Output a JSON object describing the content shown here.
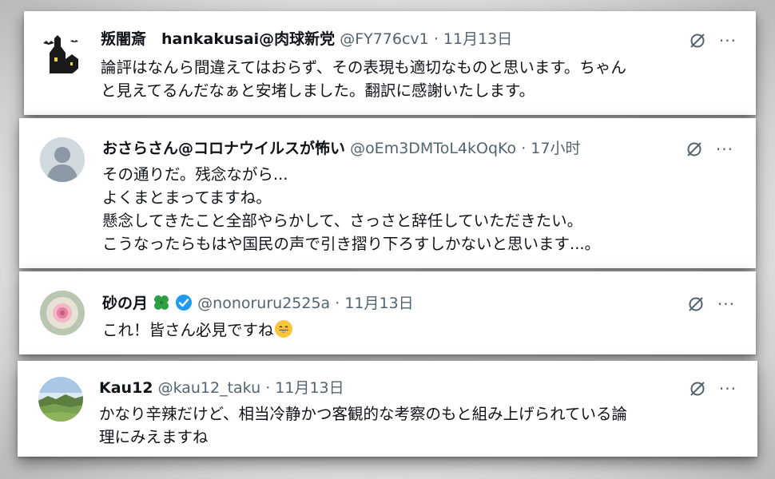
{
  "tweets": [
    {
      "name": "叛闇斎　hankakusai@肉球新党",
      "handle": "@FY776cv1",
      "time": "11月13日",
      "lines": [
        "論評はなんら間違えてはおらず、その表現も適切なものと思います。ちゃん",
        "と見えてるんだなぁと安堵しました。翻訳に感謝いたします。"
      ]
    },
    {
      "name": "おさらさん@コロナウイルスが怖い",
      "handle": "@oEm3DMToL4kOqKo",
      "time": "17小时",
      "lines": [
        "その通りだ。残念ながら...",
        "よくまとまってますね。",
        "懸念してきたこと全部やらかして、さっさと辞任していただきたい。",
        "こうなったらもはや国民の声で引き摺り下ろすしかないと思います...。"
      ]
    },
    {
      "name": "砂の月",
      "handle": "@nonoruru2525a",
      "time": "11月13日",
      "lines": [
        "これ！皆さん必見ですね"
      ]
    },
    {
      "name": "Kau12",
      "handle": "@kau12_taku",
      "time": "11月13日",
      "lines": [
        "かなり辛辣だけど、相当冷静かつ客観的な考察のもと組み上げられている論",
        "理にみえますね"
      ]
    }
  ],
  "separator": " · ",
  "more_label": "···",
  "icons": {
    "no_share": "no-share-icon",
    "more": "more-icon",
    "clover": "four-leaf-clover-icon",
    "verified": "verified-badge-icon",
    "smile": "grinning-emoji-icon"
  },
  "colors": {
    "text": "#0f1419",
    "secondary": "#536471",
    "verified": "#1d9bf0",
    "clover": "#2ea043"
  }
}
